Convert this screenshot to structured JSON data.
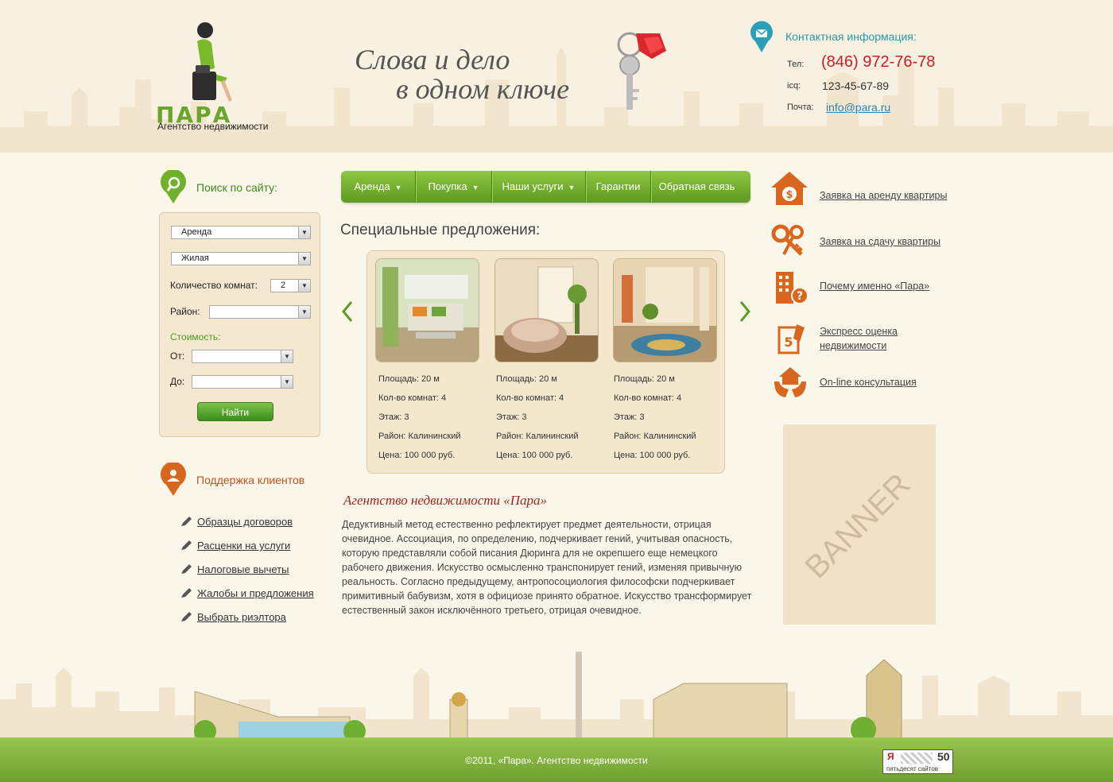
{
  "brand": {
    "logo_title": "ПАРА",
    "subtitle": "Агентство недвижимости"
  },
  "slogan": {
    "line1": "Слова и дело",
    "line2": "в одном ключе"
  },
  "contacts": {
    "title": "Контактная информация:",
    "tel_label": "Тел:",
    "tel": "(846) 972-76-78",
    "icq_label": "icq:",
    "icq": "123-45-67-89",
    "mail_label": "Почта:",
    "mail": "info@para.ru"
  },
  "search": {
    "title": "Поиск по сайту:",
    "type_value": "Аренда",
    "category_value": "Жилая",
    "rooms_label": "Количество комнат:",
    "rooms_value": "2",
    "district_label": "Район:",
    "district_value": "",
    "cost_label": "Стоимость:",
    "from_label": "От:",
    "to_label": "До:",
    "submit": "Найти"
  },
  "support": {
    "title": "Поддержка клиентов",
    "items": [
      {
        "label": "Образцы договоров"
      },
      {
        "label": "Расценки на услуги"
      },
      {
        "label": "Налоговые вычеты"
      },
      {
        "label": "Жалобы и предложения"
      },
      {
        "label": "Выбрать риэлтора"
      }
    ]
  },
  "nav": {
    "items": [
      {
        "label": "Аренда"
      },
      {
        "label": "Покупка"
      },
      {
        "label": "Наши услуги"
      },
      {
        "label": "Гарантии"
      },
      {
        "label": "Обратная связь"
      }
    ]
  },
  "offers": {
    "title": "Специальные предложения:",
    "items": [
      {
        "area": "Площадь:   20 м",
        "rooms": "Кол-во комнат:   4",
        "floor": "Этаж:   3",
        "district": "Район: Калининский",
        "price": "Цена:  100 000 руб."
      },
      {
        "area": "Площадь:   20 м",
        "rooms": "Кол-во комнат:   4",
        "floor": "Этаж:   3",
        "district": "Район: Калининский",
        "price": "Цена:  100 000 руб."
      },
      {
        "area": "Площадь:   20 м",
        "rooms": "Кол-во комнат:   4",
        "floor": "Этаж:   3",
        "district": "Район: Калининский",
        "price": "Цена:  100 000 руб."
      }
    ]
  },
  "about": {
    "title": "Агентство недвижимости «Пара»",
    "text": "Дедуктивный метод естественно рефлектирует предмет деятельности, отрицая очевидное. Ассоциация, по определению, подчеркивает гений, учитывая опасность, которую представляли собой писания Дюринга для не окрепшего еще немецкого рабочего движения. Искусство осмысленно транспонирует гений, изменяя привычную реальность. Согласно предыдущему, антропосоциология философски подчеркивает примитивный бабувизм, хотя в официозе принято обратное. Искусство трансформирует естественный закон исключённого третьего, отрицая очевидное."
  },
  "quick_links": {
    "items": [
      {
        "label": "Заявка на аренду квартиры",
        "icon": "house-money-icon"
      },
      {
        "label": "Заявка на сдачу квартиры",
        "icon": "keys-icon"
      },
      {
        "label": "Почему именно «Пара»",
        "icon": "building-question-icon"
      },
      {
        "label": "Экспресс оценка",
        "label2": "недвижимости",
        "icon": "rating-icon"
      },
      {
        "label": "On-line консультация",
        "icon": "hands-house-icon"
      }
    ]
  },
  "banner": {
    "text": "BANNER"
  },
  "footer": {
    "copyright": "©2011, «Пара». Агентство недвижимости",
    "counter_top": "Я",
    "counter_num": "50",
    "counter_bottom": "пятьдесят сайтов"
  },
  "colors": {
    "accent_green": "#6aa52c",
    "accent_orange": "#d8661e",
    "phone_red": "#c32028",
    "link_blue": "#2686b0"
  }
}
